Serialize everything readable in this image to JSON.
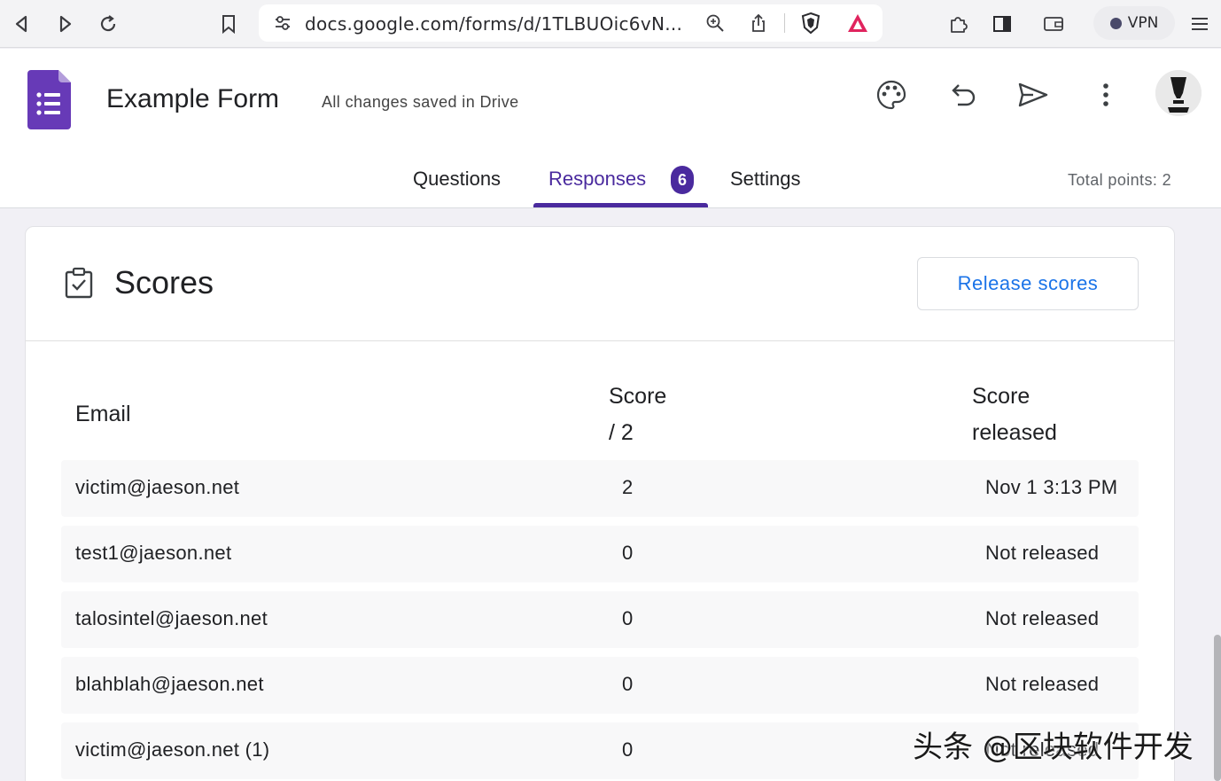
{
  "browser": {
    "url": "docs.google.com/forms/d/1TLBUOic6vN...",
    "vpn_label": "VPN",
    "icons": [
      "back-icon",
      "forward-icon",
      "reload-icon",
      "bookmark-icon",
      "site-settings-icon",
      "zoom-icon",
      "share-icon",
      "brave-shield-icon",
      "brave-rewards-icon",
      "extensions-icon",
      "sidebar-icon",
      "wallet-icon",
      "menu-icon"
    ]
  },
  "header": {
    "title": "Example Form",
    "save_status": "All changes saved in Drive",
    "icons": [
      "palette-icon",
      "undo-icon",
      "send-icon",
      "more-vert-icon"
    ]
  },
  "tabs": [
    {
      "label": "Questions",
      "active": false
    },
    {
      "label": "Responses",
      "active": true,
      "badge": "6"
    },
    {
      "label": "Settings",
      "active": false
    }
  ],
  "total_points": "Total points: 2",
  "scores": {
    "title": "Scores",
    "release_button": "Release scores",
    "columns": {
      "email": "Email",
      "score_line1": "Score",
      "score_line2": "/ 2",
      "released_line1": "Score",
      "released_line2": "released"
    },
    "rows": [
      {
        "email": "victim@jaeson.net",
        "score": "2",
        "released": "Nov 1 3:13 PM"
      },
      {
        "email": "test1@jaeson.net",
        "score": "0",
        "released": "Not released"
      },
      {
        "email": "talosintel@jaeson.net",
        "score": "0",
        "released": "Not released"
      },
      {
        "email": "blahblah@jaeson.net",
        "score": "0",
        "released": "Not released"
      },
      {
        "email": "victim@jaeson.net (1)",
        "score": "0",
        "released": "Not released"
      }
    ]
  },
  "watermark": "头条 @区块软件开发",
  "colors": {
    "accent": "#4a2a9e",
    "forms_purple": "#673ab7",
    "link_blue": "#1a73e8"
  }
}
